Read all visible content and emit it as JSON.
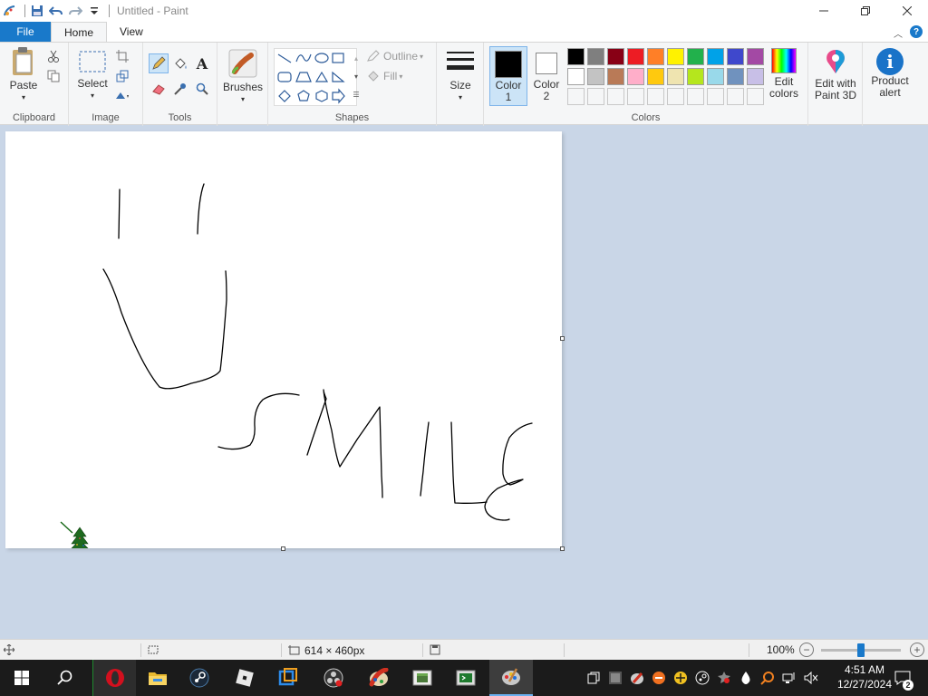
{
  "window": {
    "title": "Untitled - Paint"
  },
  "tabs": {
    "file": "File",
    "home": "Home",
    "view": "View"
  },
  "ribbon": {
    "clipboard": {
      "paste": "Paste",
      "group": "Clipboard"
    },
    "image": {
      "select": "Select",
      "group": "Image"
    },
    "tools": {
      "group": "Tools"
    },
    "brushes": {
      "label": "Brushes"
    },
    "shapes": {
      "outline": "Outline",
      "fill": "Fill",
      "group": "Shapes"
    },
    "size": {
      "label": "Size"
    },
    "colors": {
      "color1_line1": "Color",
      "color1_line2": "1",
      "color2_line1": "Color",
      "color2_line2": "2",
      "group": "Colors",
      "edit_line1": "Edit",
      "edit_line2": "colors",
      "palette_row1": [
        "#000000",
        "#7f7f7f",
        "#880015",
        "#ed1c24",
        "#ff7f27",
        "#fff200",
        "#22b14c",
        "#00a2e8",
        "#3f48cc",
        "#a349a4"
      ],
      "palette_row2": [
        "#ffffff",
        "#c3c3c3",
        "#b97a57",
        "#ffaec9",
        "#ffc90e",
        "#efe4b0",
        "#b5e61d",
        "#99d9ea",
        "#7092be",
        "#c8bfe7"
      ],
      "color1": "#000000",
      "color2": "#ffffff"
    },
    "paint3d": {
      "line1": "Edit with",
      "line2": "Paint 3D"
    },
    "alert": {
      "line1": "Product",
      "line2": "alert"
    }
  },
  "canvas": {
    "drawing_text": "SMILE"
  },
  "status": {
    "canvas_size": "614 × 460px",
    "zoom": "100%",
    "zoom_level": 0.5
  },
  "taskbar": {
    "time": "4:51 AM",
    "date": "12/27/2024",
    "notifications": "2"
  },
  "icons": {
    "start": "windows-start-icon",
    "search": "search-icon",
    "opera": "opera-icon",
    "explorer": "file-explorer-icon",
    "steam": "steam-icon",
    "roblox": "roblox-icon",
    "paint": "paint-icon"
  }
}
